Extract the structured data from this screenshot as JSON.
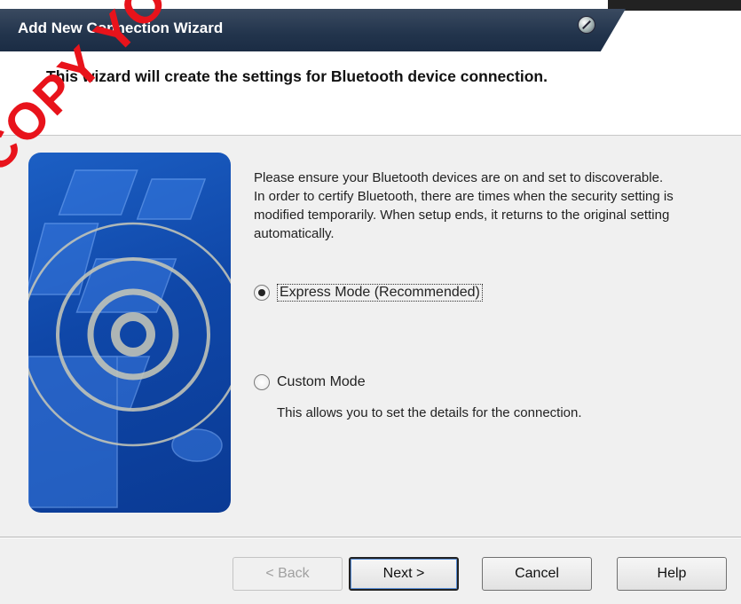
{
  "window": {
    "title": "Add New Connection Wizard",
    "accent": "#22344c"
  },
  "header": {
    "text": "This wizard will create the settings for Bluetooth device connection."
  },
  "body": {
    "para1": "Please ensure your Bluetooth devices are on and set to discoverable.",
    "para2": "In order to certify Bluetooth, there are times when the security setting is modified temporarily. When setup ends, it returns to the original setting automatically."
  },
  "options": {
    "express": {
      "label": "Express Mode (Recommended)",
      "checked": true
    },
    "custom": {
      "label": "Custom Mode",
      "checked": false,
      "description": "This allows you to set the details for the connection."
    }
  },
  "buttons": {
    "back": "< Back",
    "next": "Next >",
    "cancel": "Cancel",
    "help": "Help"
  },
  "watermark": "COPY YOU"
}
